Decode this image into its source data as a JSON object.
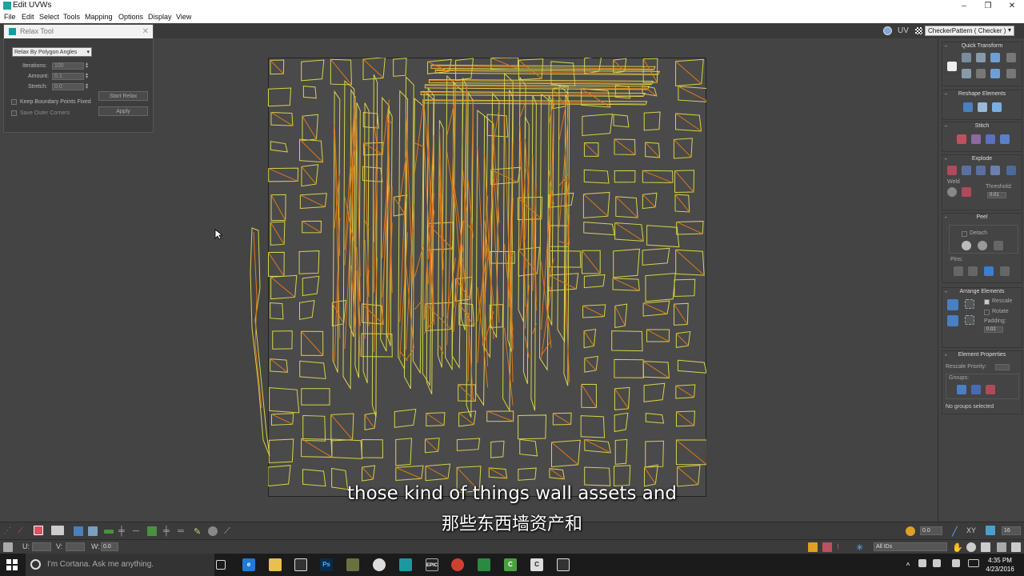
{
  "window": {
    "title": "Edit UVWs",
    "min": "–",
    "max": "❐",
    "close": "✕"
  },
  "menu": [
    "File",
    "Edit",
    "Select",
    "Tools",
    "Mapping",
    "Options",
    "Display",
    "View"
  ],
  "toolbar": {
    "uv_label": "UV",
    "map_dropdown": "CheckerPattern  ( Checker )"
  },
  "relax": {
    "title": "Relax Tool",
    "mode": "Relax By Polygon Angles",
    "iterations_label": "Iterations:",
    "iterations": "100",
    "amount_label": "Amount:",
    "amount": "0.1",
    "stretch_label": "Stretch:",
    "stretch": "0.0",
    "keep_boundary": "Keep Boundary Points Fixed",
    "save_outer": "Save Outer Corners",
    "start_btn": "Start Relax",
    "apply_btn": "Apply"
  },
  "panel": {
    "quick_transform": "Quick Transform",
    "reshape": "Reshape Elements",
    "stitch": "Stitch",
    "explode": "Explode",
    "weld": "Weld",
    "threshold": "Threshold:",
    "threshold_val": "0.01",
    "peel": "Peel",
    "detach": "Detach",
    "pins": "Pins:",
    "arrange": "Arrange Elements",
    "rescale": "Rescale",
    "rotate": "Rotate",
    "padding": "Padding:",
    "padding_val": "0.02",
    "element_props": "Element Properties",
    "rescale_priority": "Rescale Priority:",
    "groups": "Groups:",
    "no_groups": "No groups selected"
  },
  "bottom": {
    "u_label": "U:",
    "v_label": "V:",
    "w_label": "W:",
    "w_val": "0.0",
    "xy": "XY",
    "zoom_val": "0.0",
    "ids": "All IDs",
    "count": "16"
  },
  "subtitle": {
    "en": "those kind of things wall assets and",
    "zh": "那些东西墙资产和"
  },
  "taskbar": {
    "cortana": "I'm Cortana. Ask me anything.",
    "time": "4:35 PM",
    "date": "4/23/2016"
  },
  "colors": {
    "edge_yellow": "#d8d24a",
    "edge_orange": "#e07818",
    "uv_bg": "#4a4a4a"
  }
}
